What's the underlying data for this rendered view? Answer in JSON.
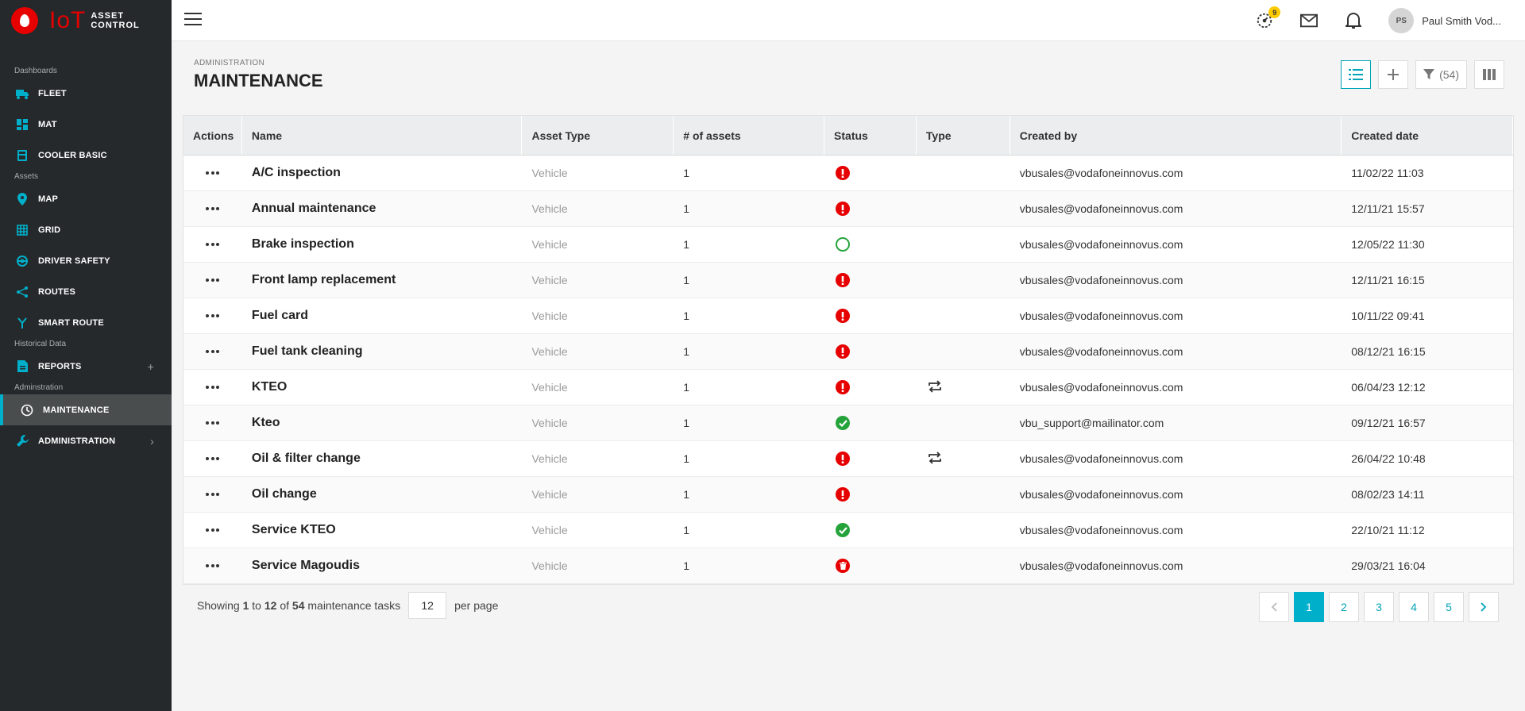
{
  "brand": {
    "iot": "IoT",
    "line1": "ASSET",
    "line2": "CONTROL"
  },
  "sidebar": {
    "sections": [
      {
        "label": "Dashboards",
        "items": [
          {
            "label": "FLEET",
            "icon": "truck-icon"
          },
          {
            "label": "MAT",
            "icon": "dashboard-icon"
          },
          {
            "label": "COOLER BASIC",
            "icon": "fridge-icon"
          }
        ]
      },
      {
        "label": "Assets",
        "items": [
          {
            "label": "MAP",
            "icon": "map-pin-icon"
          },
          {
            "label": "GRID",
            "icon": "grid-icon"
          },
          {
            "label": "DRIVER SAFETY",
            "icon": "steering-icon"
          },
          {
            "label": "ROUTES",
            "icon": "route-icon"
          },
          {
            "label": "SMART ROUTE",
            "icon": "fork-icon"
          }
        ]
      },
      {
        "label": "Historical Data",
        "items": [
          {
            "label": "REPORTS",
            "icon": "reports-icon",
            "trail": "+"
          }
        ]
      },
      {
        "label": "Adminstration",
        "items": [
          {
            "label": "MAINTENANCE",
            "icon": "maintenance-icon",
            "active": true
          },
          {
            "label": "ADMINISTRATION",
            "icon": "wrench-icon",
            "trail": "›"
          }
        ]
      }
    ]
  },
  "topbar": {
    "alerts_badge": "9",
    "user_initials": "PS",
    "user_name": "Paul Smith Vod..."
  },
  "page": {
    "breadcrumb": "ADMINISTRATION",
    "title": "MAINTENANCE",
    "filter_count": "(54)"
  },
  "table": {
    "headers": [
      "Actions",
      "Name",
      "Asset Type",
      "# of assets",
      "Status",
      "Type",
      "Created by",
      "Created date"
    ],
    "rows": [
      {
        "name": "A/C inspection",
        "asset_type": "Vehicle",
        "assets": "1",
        "status": "overdue",
        "type": "",
        "created_by": "vbusales@vodafoneinnovus.com",
        "created_date": "11/02/22 11:03"
      },
      {
        "name": "Annual maintenance",
        "asset_type": "Vehicle",
        "assets": "1",
        "status": "overdue",
        "type": "",
        "created_by": "vbusales@vodafoneinnovus.com",
        "created_date": "12/11/21 15:57"
      },
      {
        "name": "Brake inspection",
        "asset_type": "Vehicle",
        "assets": "1",
        "status": "pending",
        "type": "",
        "created_by": "vbusales@vodafoneinnovus.com",
        "created_date": "12/05/22 11:30"
      },
      {
        "name": "Front lamp replacement",
        "asset_type": "Vehicle",
        "assets": "1",
        "status": "overdue",
        "type": "",
        "created_by": "vbusales@vodafoneinnovus.com",
        "created_date": "12/11/21 16:15"
      },
      {
        "name": "Fuel card",
        "asset_type": "Vehicle",
        "assets": "1",
        "status": "overdue",
        "type": "",
        "created_by": "vbusales@vodafoneinnovus.com",
        "created_date": "10/11/22 09:41"
      },
      {
        "name": "Fuel tank cleaning",
        "asset_type": "Vehicle",
        "assets": "1",
        "status": "overdue",
        "type": "",
        "created_by": "vbusales@vodafoneinnovus.com",
        "created_date": "08/12/21 16:15"
      },
      {
        "name": "KTEO",
        "asset_type": "Vehicle",
        "assets": "1",
        "status": "overdue",
        "type": "recurring",
        "created_by": "vbusales@vodafoneinnovus.com",
        "created_date": "06/04/23 12:12"
      },
      {
        "name": "Kteo",
        "asset_type": "Vehicle",
        "assets": "1",
        "status": "done",
        "type": "",
        "created_by": "vbu_support@mailinator.com",
        "created_date": "09/12/21 16:57"
      },
      {
        "name": "Oil & filter change",
        "asset_type": "Vehicle",
        "assets": "1",
        "status": "overdue",
        "type": "recurring",
        "created_by": "vbusales@vodafoneinnovus.com",
        "created_date": "26/04/22 10:48"
      },
      {
        "name": "Oil change",
        "asset_type": "Vehicle",
        "assets": "1",
        "status": "overdue",
        "type": "",
        "created_by": "vbusales@vodafoneinnovus.com",
        "created_date": "08/02/23 14:11"
      },
      {
        "name": "Service KTEO",
        "asset_type": "Vehicle",
        "assets": "1",
        "status": "done",
        "type": "",
        "created_by": "vbusales@vodafoneinnovus.com",
        "created_date": "22/10/21 11:12"
      },
      {
        "name": "Service Magoudis",
        "asset_type": "Vehicle",
        "assets": "1",
        "status": "deleted",
        "type": "",
        "created_by": "vbusales@vodafoneinnovus.com",
        "created_date": "29/03/21 16:04"
      }
    ]
  },
  "footer": {
    "showing": "Showing",
    "from": "1",
    "to_word": "to",
    "to": "12",
    "of_word": "of",
    "total": "54",
    "suffix": "maintenance tasks",
    "per_page_value": "12",
    "per_page_label": "per page"
  },
  "pagination": {
    "pages": [
      "1",
      "2",
      "3",
      "4",
      "5"
    ],
    "current": "1"
  },
  "colors": {
    "accent": "#00b0ca",
    "brand_red": "#e60000",
    "status_red": "#e60000",
    "status_green": "#25a33b",
    "sidebar_bg": "#25292c"
  }
}
